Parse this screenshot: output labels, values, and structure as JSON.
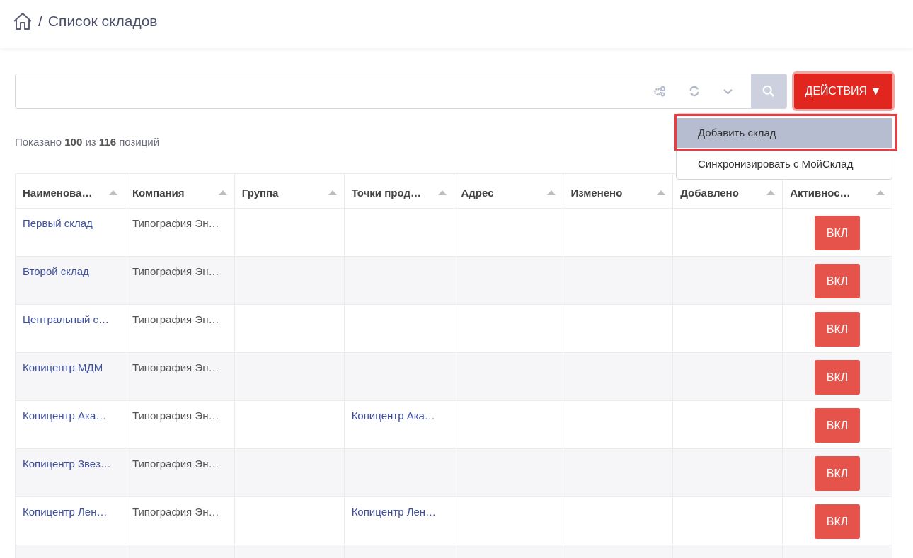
{
  "breadcrumb": {
    "separator": "/",
    "title": "Список складов"
  },
  "actions_button": {
    "label": "ДЕЙСТВИЯ",
    "caret": "▼",
    "expanded": true
  },
  "actions_menu": [
    {
      "label": "Добавить склад",
      "selected": true
    },
    {
      "label": "Синхронизировать с МойСклад",
      "selected": false
    }
  ],
  "summary": "Показано **100** из **116** позиций",
  "table": {
    "columns": [
      "Наименова…",
      "Компания",
      "Группа",
      "Точки прод…",
      "Адрес",
      "Изменено",
      "Добавлено",
      "Активнос…"
    ],
    "rows": [
      {
        "name": "Первый склад",
        "company": "Типография Эн…",
        "active": {
          "label": "ВКЛ",
          "on": true
        }
      },
      {
        "name": "Второй склад",
        "company": "Типография Эн…",
        "active": {
          "label": "ВКЛ",
          "on": true
        }
      },
      {
        "name": "Центральный с…",
        "company": "Типография Эн…",
        "active": {
          "label": "ВКЛ",
          "on": true
        }
      },
      {
        "name": "Копицентр МДМ",
        "company": "Типография Эн…",
        "active": {
          "label": "ВКЛ",
          "on": true
        }
      },
      {
        "name": "Копицентр Ака…",
        "company": "Типография Эн…",
        "points": "Копицентр Ака…",
        "active": {
          "label": "ВКЛ",
          "on": true
        }
      },
      {
        "name": "Копицентр Звез…",
        "company": "Типография Эн…",
        "active": {
          "label": "ВКЛ",
          "on": true
        }
      },
      {
        "name": "Копицентр Лен…",
        "company": "Типография Эн…",
        "points": "Копицентр Лен…",
        "active": {
          "label": "ВКЛ",
          "on": true
        }
      }
    ]
  }
}
